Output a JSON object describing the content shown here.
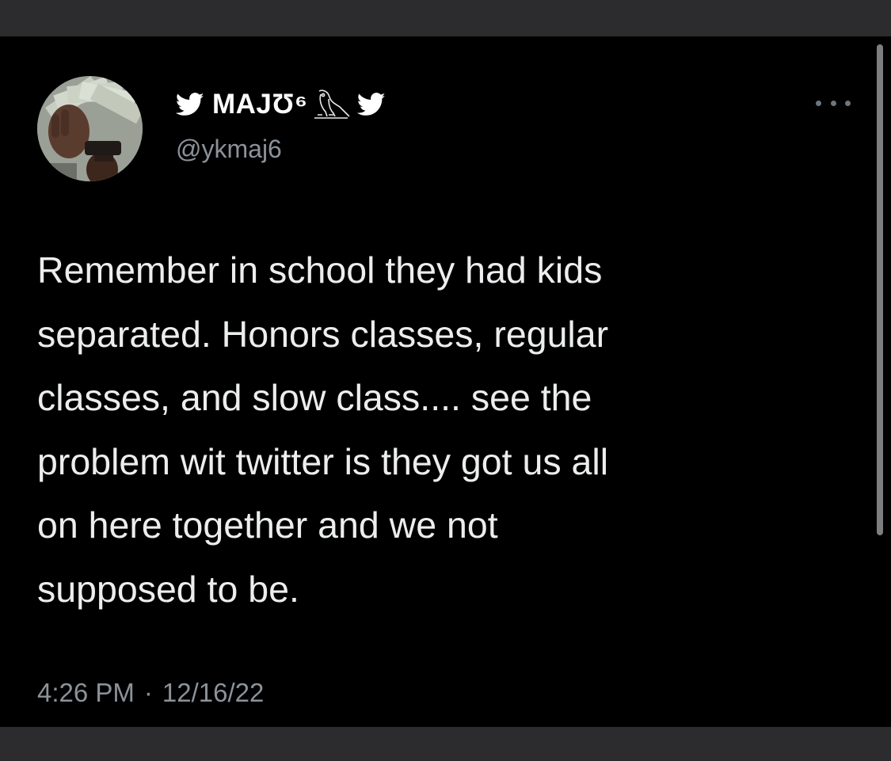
{
  "tweet": {
    "author": {
      "display_name": "MAJƱ⁶",
      "handle": "@ykmaj6",
      "name_prefix_icon": "twitter-bird-icon",
      "name_suffix_icons": [
        "owl-icon",
        "twitter-bird-icon"
      ],
      "avatar": "profile-photo"
    },
    "text": "Remember in school they had kids\nseparated. Honors classes, regular\nclasses, and slow class.... see the\nproblem wit twitter is they got us all\non here together and we not\nsupposed to be.",
    "time": "4:26 PM",
    "separator": "·",
    "date": "12/16/22",
    "more_icon": "more-options-icon"
  },
  "colors": {
    "background": "#000000",
    "outer_frame": "#2c2c2e",
    "primary_text": "#ecedee",
    "secondary_text": "#8b9299"
  }
}
